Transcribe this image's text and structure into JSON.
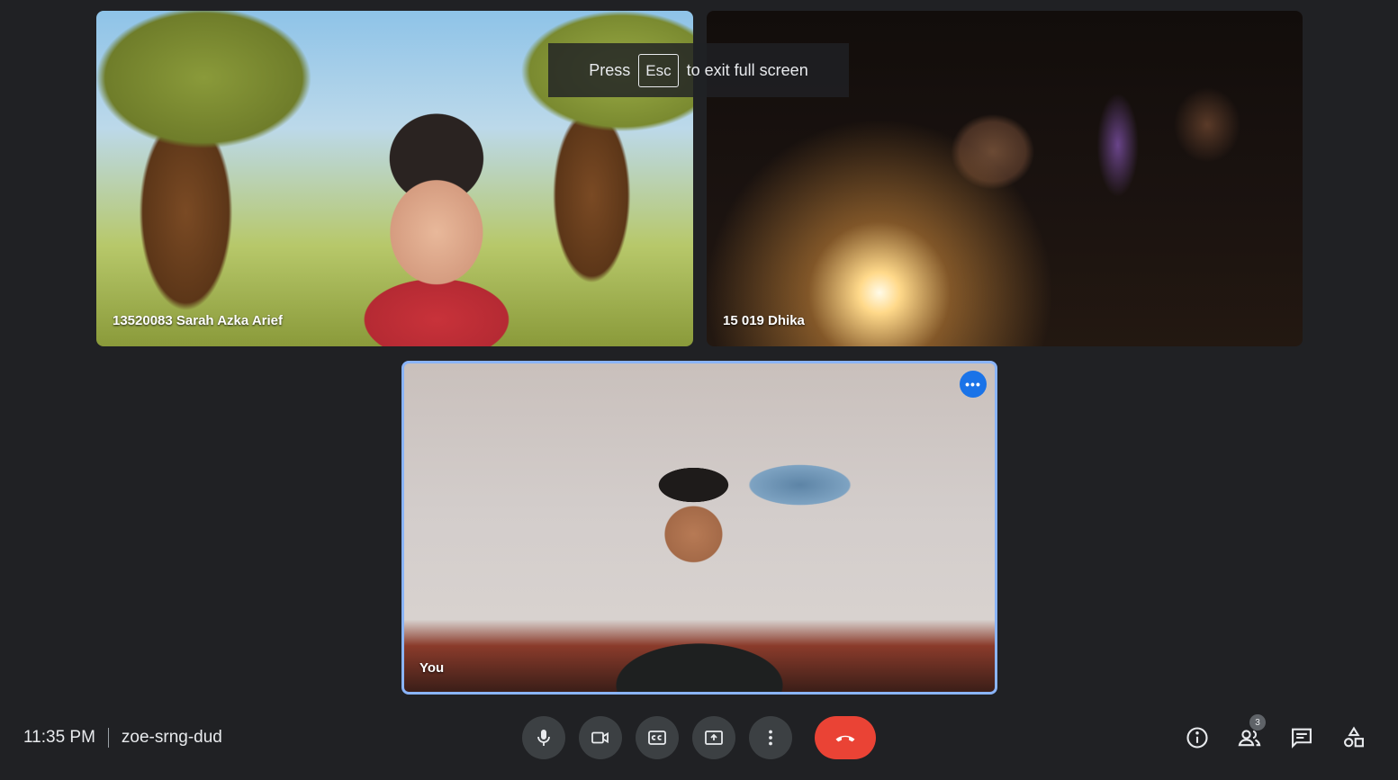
{
  "banner": {
    "press": "Press",
    "key": "Esc",
    "suffix": "to exit full screen"
  },
  "participants": [
    {
      "name": "13520083 Sarah Azka Arief"
    },
    {
      "name": "15 019 Dhika"
    },
    {
      "name": "You",
      "highlighted": true
    }
  ],
  "meeting": {
    "time": "11:35 PM",
    "code": "zoe-srng-dud"
  },
  "controls": {
    "mic": "microphone-icon",
    "camera": "camera-icon",
    "captions": "captions-icon",
    "present": "present-screen-icon",
    "more": "more-options-icon",
    "end": "end-call-icon"
  },
  "side_panel": {
    "info": "info-icon",
    "people": "people-icon",
    "people_badge": "3",
    "chat": "chat-icon",
    "activities": "activities-icon"
  },
  "colors": {
    "accent": "#8ab4f8",
    "end_call": "#ea4335",
    "tile_menu": "#1a73e8",
    "background": "#202124"
  }
}
